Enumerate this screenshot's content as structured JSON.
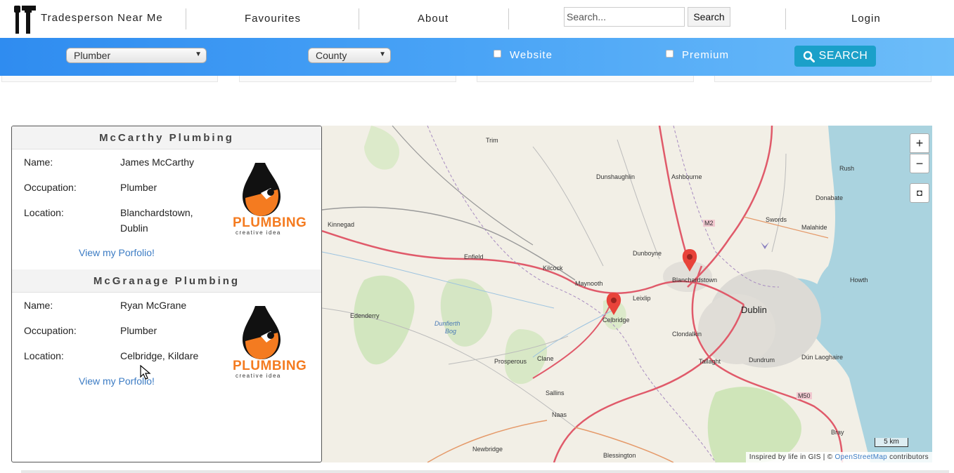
{
  "nav": {
    "brand": "Tradesperson Near Me",
    "favourites": "Favourites",
    "about": "About",
    "search_placeholder": "Search...",
    "search_button": "Search",
    "login": "Login"
  },
  "filters": {
    "trade_selected": "Plumber",
    "county_selected": "County",
    "website_label": "Website",
    "premium_label": "Premium",
    "search_button": "SEARCH"
  },
  "results": [
    {
      "business": "McCarthy Plumbing",
      "name_label": "Name:",
      "name": "James McCarthy",
      "occupation_label": "Occupation:",
      "occupation": "Plumber",
      "location_label": "Location:",
      "location_line1": "Blanchardstown,",
      "location_line2": "Dublin",
      "portfolio_link": "View my Porfolio!",
      "logo_text": "PLUMBING",
      "logo_subtext": "creative idea"
    },
    {
      "business": "McGranage Plumbing",
      "name_label": "Name:",
      "name": "Ryan McGrane",
      "occupation_label": "Occupation:",
      "occupation": "Plumber",
      "location_label": "Location:",
      "location_line1": "Celbridge, Kildare",
      "location_line2": "",
      "portfolio_link": "View my Porfolio!",
      "logo_text": "PLUMBING",
      "logo_subtext": "creative idea"
    }
  ],
  "map": {
    "places": {
      "trim": "Trim",
      "dunshaughlin": "Dunshaughlin",
      "ashbourne": "Ashbourne",
      "rush": "Rush",
      "donabate": "Donabate",
      "kinnegad": "Kinnegad",
      "m2": "M2",
      "swords": "Swords",
      "malahide": "Malahide",
      "enfield": "Enfield",
      "dunboyne": "Dunboyne",
      "kilcock": "Kilcock",
      "blanchardstown": "Blanchardstown",
      "howth": "Howth",
      "maynooth": "Maynooth",
      "leixlip": "Leixlip",
      "dublin": "Dublin",
      "edenderry": "Edenderry",
      "celbridge": "Celbridge",
      "dunfierth": "Dunfierth",
      "bog": "Bog",
      "clondalkin": "Clondalkin",
      "prosperous": "Prosperous",
      "clane": "Clane",
      "tallaght": "Tallaght",
      "dundrum": "Dundrum",
      "dun_laoghaire": "Dún Laoghaire",
      "sallins": "Sallins",
      "m50": "M50",
      "naas": "Naas",
      "bray": "Bray",
      "newbridge": "Newbridge",
      "blessington": "Blessington"
    },
    "zoom_in": "+",
    "zoom_out": "−",
    "fullscreen": "◘",
    "scale": "5 km",
    "attribution_prefix": "Inspired by life in GIS | ©",
    "attribution_link": "OpenStreetMap",
    "attribution_suffix": "contributors"
  },
  "colors": {
    "filter_bar_start": "#2f8cf0",
    "filter_bar_end": "#6dbdf9",
    "search_button": "#1ba0c9",
    "link": "#3c7cc4",
    "marker": "#e8433a",
    "sea": "#aad3df",
    "logo_orange": "#f47b20"
  },
  "icons": {
    "brand": "tools-icon",
    "search_button": "magnifier-icon",
    "marker": "map-pin-icon",
    "logo": "plumbing-drop-wrench-icon"
  }
}
